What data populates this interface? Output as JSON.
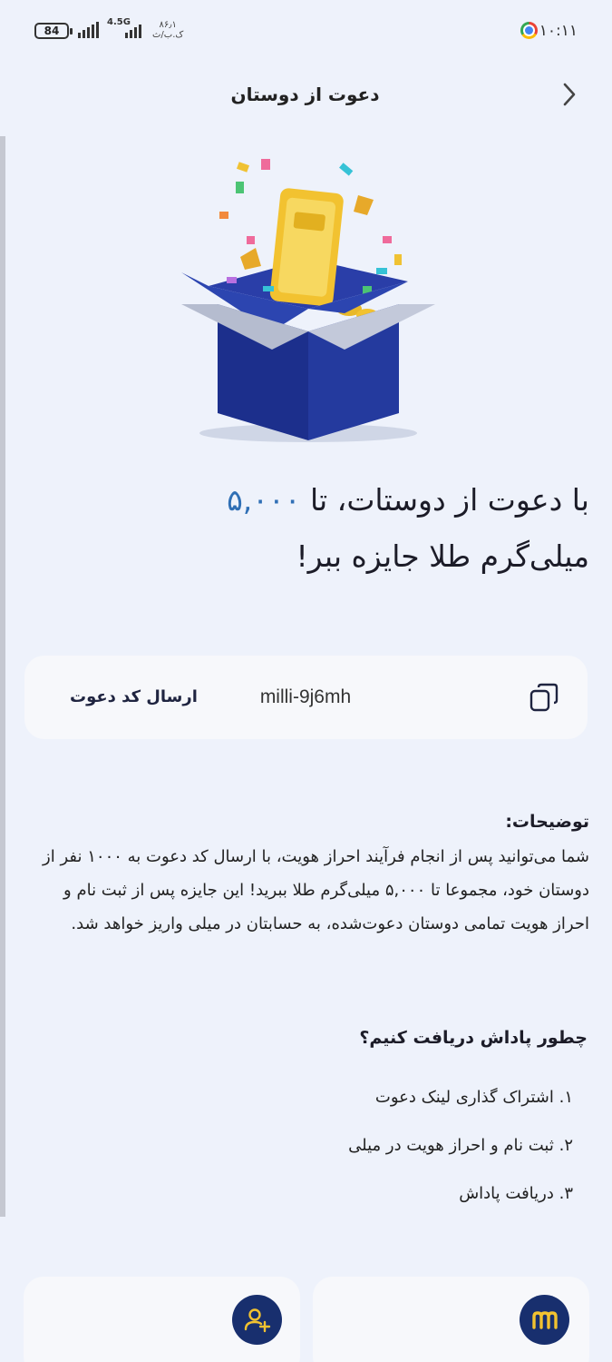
{
  "status_bar": {
    "time": "۱۰:۱۱",
    "battery": "84",
    "network": "4.5G",
    "speed_value": "۸۶٫۱",
    "speed_unit": "ک.ب/ث"
  },
  "header": {
    "title": "دعوت از دوستان"
  },
  "hero": {
    "headline_prefix": "با دعوت از دوستات، تا ",
    "headline_amount": "۵,۰۰۰",
    "headline_suffix": " میلی‌گرم طلا جایزه ببر!"
  },
  "invite": {
    "send_label": "ارسال کد دعوت",
    "code": "milli-9j6mh"
  },
  "description": {
    "title": "توضیحات:",
    "body": "شما می‌توانید پس از انجام فرآیند احراز هویت، با ارسال کد دعوت به ۱۰۰۰ نفر از دوستان خود، مجموعا تا ۵,۰۰۰ میلی‌گرم طلا ببرید! این جایزه پس از ثبت نام و احراز هویت تمامی دوستان دعوت‌شده، به حسابتان در میلی واریز خواهد شد."
  },
  "how_to": {
    "title": "چطور پاداش دریافت کنیم؟",
    "steps": [
      "۱. اشتراک گذاری لینک دعوت",
      "۲. ثبت نام و احراز هویت در میلی",
      "۳. دریافت پاداش"
    ]
  },
  "colors": {
    "background": "#eef2fb",
    "card": "#f7f8fb",
    "accent_blue": "#2f6fb5",
    "navy": "#182f6e",
    "gold": "#f2c230"
  },
  "icons": {
    "back": "chevron-right-icon",
    "copy": "copy-icon",
    "add_user": "add-user-icon",
    "milli_logo": "milli-logo-icon"
  }
}
